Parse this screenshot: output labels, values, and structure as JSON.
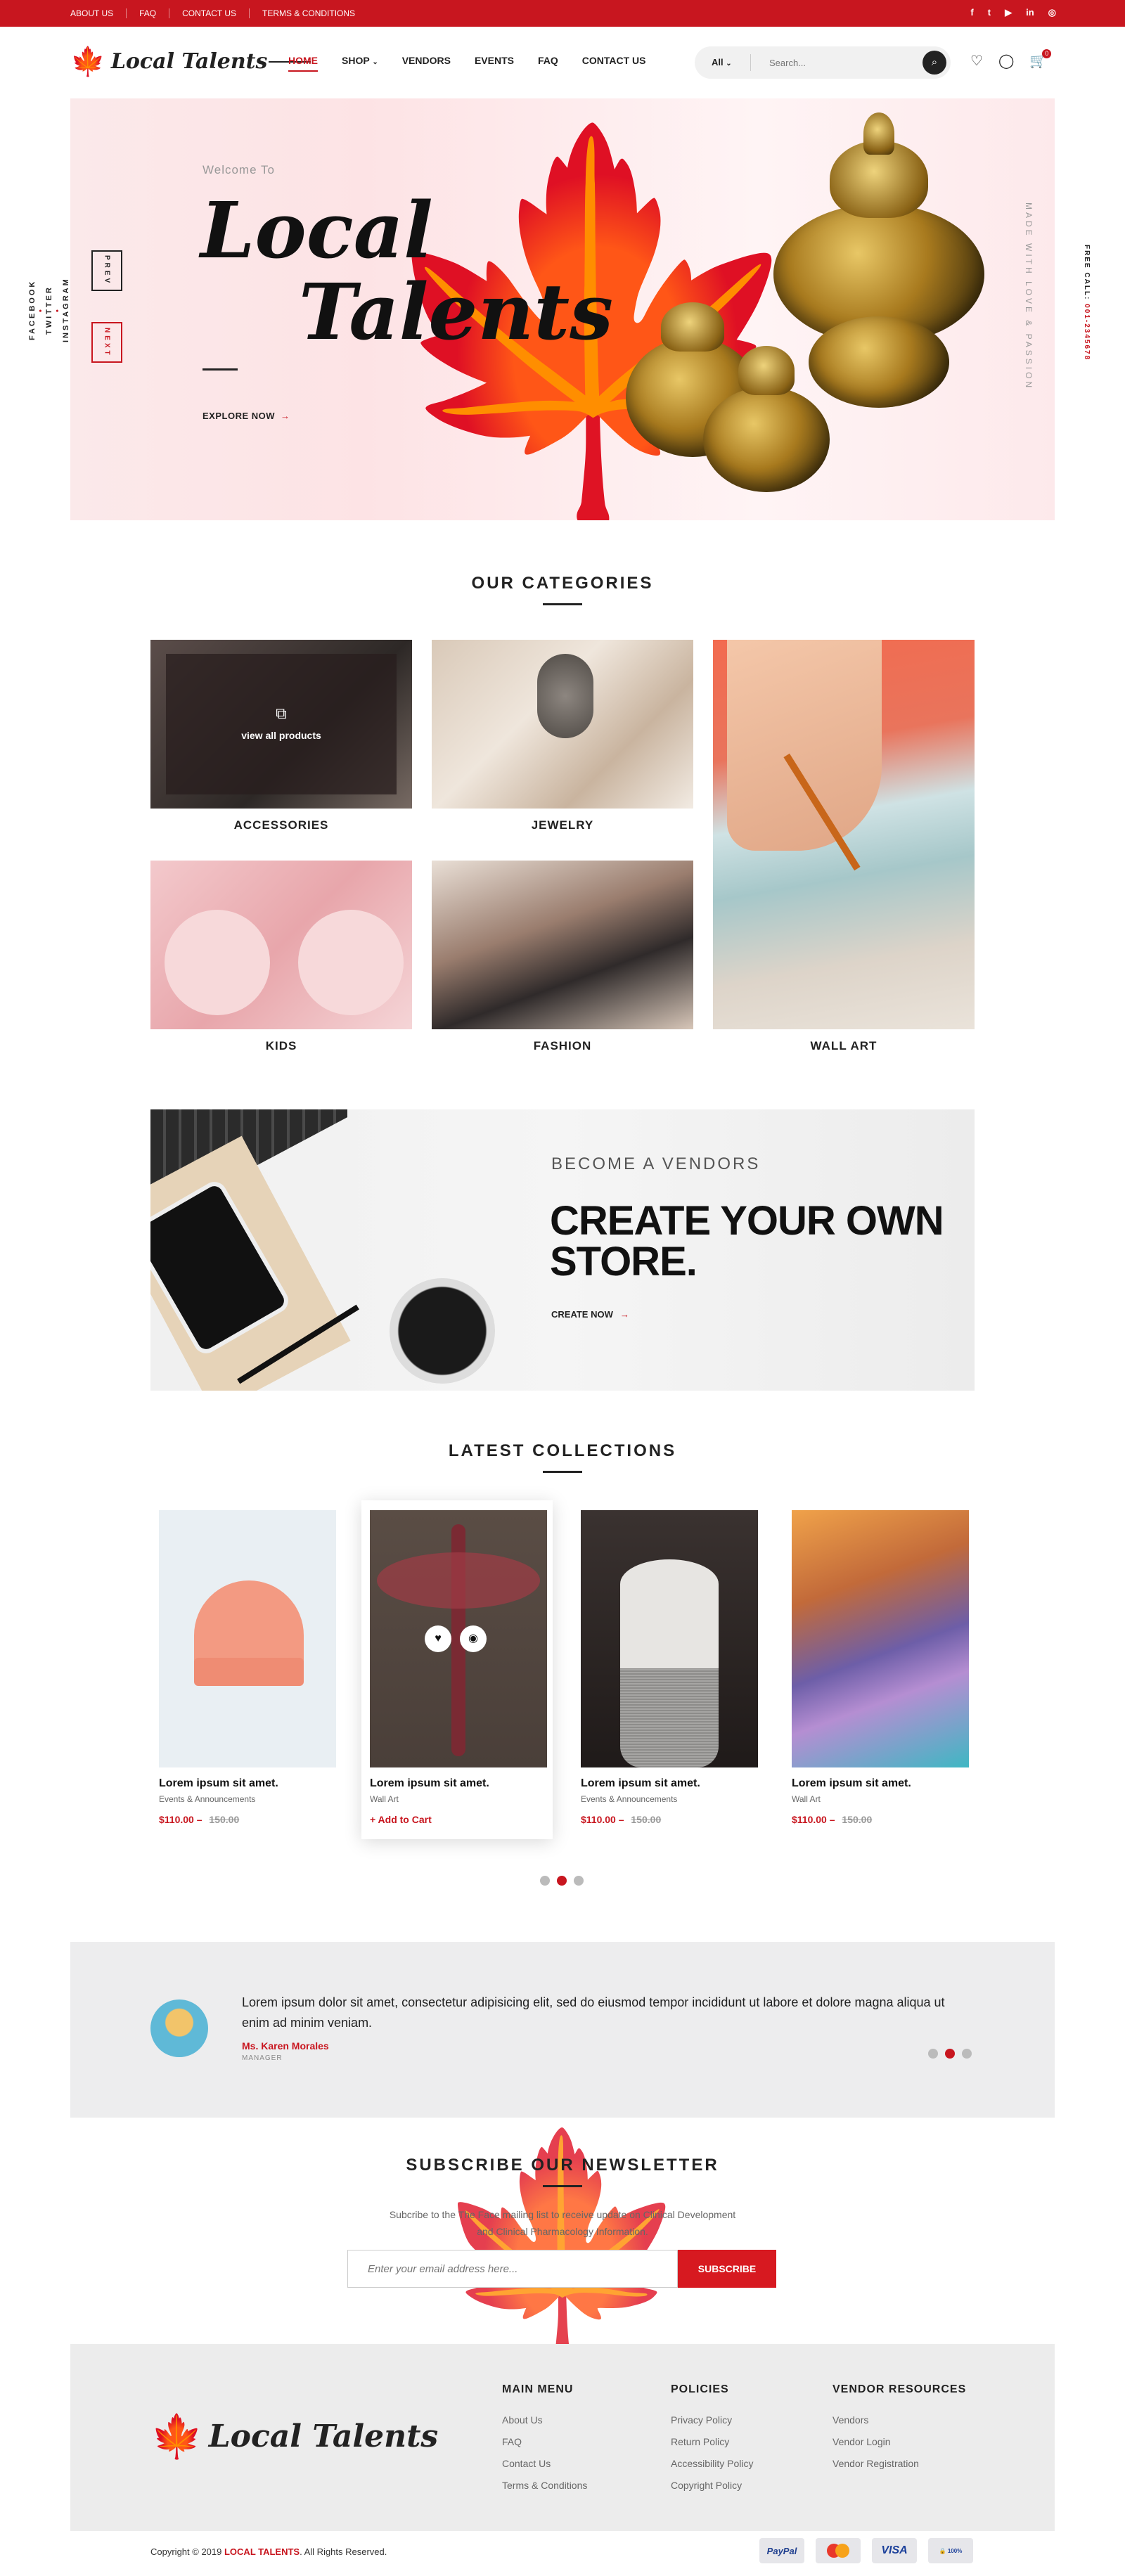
{
  "topbar": {
    "links": [
      "ABOUT US",
      "FAQ",
      "CONTACT US",
      "TERMS & CONDITIONS"
    ],
    "social": [
      "facebook-icon",
      "twitter-icon",
      "youtube-icon",
      "linkedin-icon",
      "instagram-icon"
    ]
  },
  "header": {
    "logo_text": "Local Talents",
    "nav": [
      "HOME",
      "SHOP",
      "VENDORS",
      "EVENTS",
      "FAQ",
      "CONTACT US"
    ],
    "search_category": "All",
    "search_placeholder": "Search...",
    "cart_count": "0"
  },
  "hero": {
    "welcome": "Welcome To",
    "title_line1": "Local",
    "title_line2": "Talents",
    "cta": "EXPLORE NOW",
    "prev": "PREV",
    "next": "NEXT",
    "made_with": "MADE WITH LOVE & PASSION",
    "free_call": "FREE CALL:",
    "free_call_number": "001-2345678"
  },
  "social_rail": [
    "FACEBOOK",
    "TWITTER",
    "INSTAGRAM"
  ],
  "categories": {
    "title": "OUR CATEGORIES",
    "items": [
      "ACCESSORIES",
      "JEWELRY",
      "KIDS",
      "FASHION",
      "WALL ART"
    ],
    "overlay_text": "view all products"
  },
  "vendor": {
    "eyebrow": "BECOME A VENDORS",
    "headline_1": "CREATE YOUR OWN",
    "headline_2": "STORE.",
    "cta": "CREATE NOW"
  },
  "collections": {
    "title": "LATEST COLLECTIONS",
    "products": [
      {
        "name": "Lorem ipsum sit amet.",
        "category": "Events & Announcements",
        "price": "$110.00",
        "old_price": "150.00"
      },
      {
        "name": "Lorem ipsum sit amet.",
        "category": "Wall Art",
        "action": "+ Add to Cart"
      },
      {
        "name": "Lorem ipsum sit amet.",
        "category": "Events & Announcements",
        "price": "$110.00",
        "old_price": "150.00"
      },
      {
        "name": "Lorem ipsum sit amet.",
        "category": "Wall Art",
        "price": "$110.00",
        "old_price": "150.00"
      }
    ]
  },
  "testimonial": {
    "quote": "Lorem ipsum dolor sit amet, consectetur adipisicing elit, sed do eiusmod tempor incididunt ut labore et dolore magna aliqua ut enim ad minim veniam.",
    "name": "Ms. Karen Morales",
    "role": "MANAGER"
  },
  "newsletter": {
    "title": "SUBSCRIBE OUR NEWSLETTER",
    "text_1": "Subcribe to the The Face mailing list to receive update on Clinical Development",
    "text_2": "and Clinical Pharmacology Information.",
    "placeholder": "Enter your email address here...",
    "button": "SUBSCRIBE"
  },
  "footer": {
    "logo_text": "Local Talents",
    "columns": [
      {
        "title": "MAIN MENU",
        "links": [
          "About Us",
          "FAQ",
          "Contact Us",
          "Terms & Conditions"
        ]
      },
      {
        "title": "POLICIES",
        "links": [
          "Privacy Policy",
          "Return Policy",
          "Accessibility Policy",
          "Copyright Policy"
        ]
      },
      {
        "title": "VENDOR RESOURCES",
        "links": [
          "Vendors",
          "Vendor Login",
          "Vendor Registration"
        ]
      }
    ],
    "copyright_pre": "Copyright © 2019",
    "copyright_brand": "LOCAL TALENTS",
    "copyright_post": ". All Rights Reserved.",
    "payments": [
      "PayPal",
      "MasterCard",
      "VISA",
      "100% SECURE"
    ]
  },
  "colors": {
    "accent": "#c8161f",
    "dark": "#222222",
    "muted": "#ececec"
  }
}
